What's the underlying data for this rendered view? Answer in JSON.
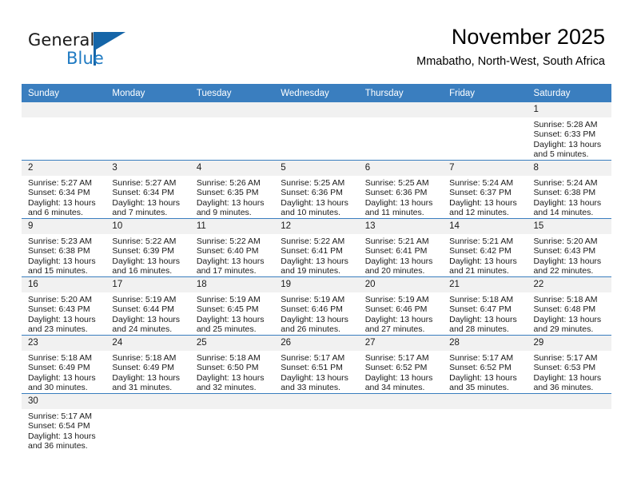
{
  "brand": {
    "name_part1": "General",
    "name_part2": "Blue",
    "flag_icon": "sail-flag-icon",
    "accent_color": "#1f7ac2"
  },
  "header": {
    "month_title": "November 2025",
    "location": "Mmabatho, North-West, South Africa"
  },
  "theme": {
    "header_row_bg": "#3a7ebf",
    "header_row_text": "#ffffff",
    "daynum_bg": "#f1f1f1",
    "grid_line": "#3a7ebf",
    "cell_bg": "#ffffff"
  },
  "weekday_headers": [
    "Sunday",
    "Monday",
    "Tuesday",
    "Wednesday",
    "Thursday",
    "Friday",
    "Saturday"
  ],
  "labels": {
    "sunrise_prefix": "Sunrise: ",
    "sunset_prefix": "Sunset: ",
    "daylight_prefix": "Daylight: "
  },
  "weeks": [
    [
      {
        "day": "",
        "empty": true,
        "sunrise": "",
        "sunset": "",
        "daylight_line1": "",
        "daylight_line2": ""
      },
      {
        "day": "",
        "empty": true,
        "sunrise": "",
        "sunset": "",
        "daylight_line1": "",
        "daylight_line2": ""
      },
      {
        "day": "",
        "empty": true,
        "sunrise": "",
        "sunset": "",
        "daylight_line1": "",
        "daylight_line2": ""
      },
      {
        "day": "",
        "empty": true,
        "sunrise": "",
        "sunset": "",
        "daylight_line1": "",
        "daylight_line2": ""
      },
      {
        "day": "",
        "empty": true,
        "sunrise": "",
        "sunset": "",
        "daylight_line1": "",
        "daylight_line2": ""
      },
      {
        "day": "",
        "empty": true,
        "sunrise": "",
        "sunset": "",
        "daylight_line1": "",
        "daylight_line2": ""
      },
      {
        "day": "1",
        "empty": false,
        "sunrise": "Sunrise: 5:28 AM",
        "sunset": "Sunset: 6:33 PM",
        "daylight_line1": "Daylight: 13 hours",
        "daylight_line2": "and 5 minutes."
      }
    ],
    [
      {
        "day": "2",
        "empty": false,
        "sunrise": "Sunrise: 5:27 AM",
        "sunset": "Sunset: 6:34 PM",
        "daylight_line1": "Daylight: 13 hours",
        "daylight_line2": "and 6 minutes."
      },
      {
        "day": "3",
        "empty": false,
        "sunrise": "Sunrise: 5:27 AM",
        "sunset": "Sunset: 6:34 PM",
        "daylight_line1": "Daylight: 13 hours",
        "daylight_line2": "and 7 minutes."
      },
      {
        "day": "4",
        "empty": false,
        "sunrise": "Sunrise: 5:26 AM",
        "sunset": "Sunset: 6:35 PM",
        "daylight_line1": "Daylight: 13 hours",
        "daylight_line2": "and 9 minutes."
      },
      {
        "day": "5",
        "empty": false,
        "sunrise": "Sunrise: 5:25 AM",
        "sunset": "Sunset: 6:36 PM",
        "daylight_line1": "Daylight: 13 hours",
        "daylight_line2": "and 10 minutes."
      },
      {
        "day": "6",
        "empty": false,
        "sunrise": "Sunrise: 5:25 AM",
        "sunset": "Sunset: 6:36 PM",
        "daylight_line1": "Daylight: 13 hours",
        "daylight_line2": "and 11 minutes."
      },
      {
        "day": "7",
        "empty": false,
        "sunrise": "Sunrise: 5:24 AM",
        "sunset": "Sunset: 6:37 PM",
        "daylight_line1": "Daylight: 13 hours",
        "daylight_line2": "and 12 minutes."
      },
      {
        "day": "8",
        "empty": false,
        "sunrise": "Sunrise: 5:24 AM",
        "sunset": "Sunset: 6:38 PM",
        "daylight_line1": "Daylight: 13 hours",
        "daylight_line2": "and 14 minutes."
      }
    ],
    [
      {
        "day": "9",
        "empty": false,
        "sunrise": "Sunrise: 5:23 AM",
        "sunset": "Sunset: 6:38 PM",
        "daylight_line1": "Daylight: 13 hours",
        "daylight_line2": "and 15 minutes."
      },
      {
        "day": "10",
        "empty": false,
        "sunrise": "Sunrise: 5:22 AM",
        "sunset": "Sunset: 6:39 PM",
        "daylight_line1": "Daylight: 13 hours",
        "daylight_line2": "and 16 minutes."
      },
      {
        "day": "11",
        "empty": false,
        "sunrise": "Sunrise: 5:22 AM",
        "sunset": "Sunset: 6:40 PM",
        "daylight_line1": "Daylight: 13 hours",
        "daylight_line2": "and 17 minutes."
      },
      {
        "day": "12",
        "empty": false,
        "sunrise": "Sunrise: 5:22 AM",
        "sunset": "Sunset: 6:41 PM",
        "daylight_line1": "Daylight: 13 hours",
        "daylight_line2": "and 19 minutes."
      },
      {
        "day": "13",
        "empty": false,
        "sunrise": "Sunrise: 5:21 AM",
        "sunset": "Sunset: 6:41 PM",
        "daylight_line1": "Daylight: 13 hours",
        "daylight_line2": "and 20 minutes."
      },
      {
        "day": "14",
        "empty": false,
        "sunrise": "Sunrise: 5:21 AM",
        "sunset": "Sunset: 6:42 PM",
        "daylight_line1": "Daylight: 13 hours",
        "daylight_line2": "and 21 minutes."
      },
      {
        "day": "15",
        "empty": false,
        "sunrise": "Sunrise: 5:20 AM",
        "sunset": "Sunset: 6:43 PM",
        "daylight_line1": "Daylight: 13 hours",
        "daylight_line2": "and 22 minutes."
      }
    ],
    [
      {
        "day": "16",
        "empty": false,
        "sunrise": "Sunrise: 5:20 AM",
        "sunset": "Sunset: 6:43 PM",
        "daylight_line1": "Daylight: 13 hours",
        "daylight_line2": "and 23 minutes."
      },
      {
        "day": "17",
        "empty": false,
        "sunrise": "Sunrise: 5:19 AM",
        "sunset": "Sunset: 6:44 PM",
        "daylight_line1": "Daylight: 13 hours",
        "daylight_line2": "and 24 minutes."
      },
      {
        "day": "18",
        "empty": false,
        "sunrise": "Sunrise: 5:19 AM",
        "sunset": "Sunset: 6:45 PM",
        "daylight_line1": "Daylight: 13 hours",
        "daylight_line2": "and 25 minutes."
      },
      {
        "day": "19",
        "empty": false,
        "sunrise": "Sunrise: 5:19 AM",
        "sunset": "Sunset: 6:46 PM",
        "daylight_line1": "Daylight: 13 hours",
        "daylight_line2": "and 26 minutes."
      },
      {
        "day": "20",
        "empty": false,
        "sunrise": "Sunrise: 5:19 AM",
        "sunset": "Sunset: 6:46 PM",
        "daylight_line1": "Daylight: 13 hours",
        "daylight_line2": "and 27 minutes."
      },
      {
        "day": "21",
        "empty": false,
        "sunrise": "Sunrise: 5:18 AM",
        "sunset": "Sunset: 6:47 PM",
        "daylight_line1": "Daylight: 13 hours",
        "daylight_line2": "and 28 minutes."
      },
      {
        "day": "22",
        "empty": false,
        "sunrise": "Sunrise: 5:18 AM",
        "sunset": "Sunset: 6:48 PM",
        "daylight_line1": "Daylight: 13 hours",
        "daylight_line2": "and 29 minutes."
      }
    ],
    [
      {
        "day": "23",
        "empty": false,
        "sunrise": "Sunrise: 5:18 AM",
        "sunset": "Sunset: 6:49 PM",
        "daylight_line1": "Daylight: 13 hours",
        "daylight_line2": "and 30 minutes."
      },
      {
        "day": "24",
        "empty": false,
        "sunrise": "Sunrise: 5:18 AM",
        "sunset": "Sunset: 6:49 PM",
        "daylight_line1": "Daylight: 13 hours",
        "daylight_line2": "and 31 minutes."
      },
      {
        "day": "25",
        "empty": false,
        "sunrise": "Sunrise: 5:18 AM",
        "sunset": "Sunset: 6:50 PM",
        "daylight_line1": "Daylight: 13 hours",
        "daylight_line2": "and 32 minutes."
      },
      {
        "day": "26",
        "empty": false,
        "sunrise": "Sunrise: 5:17 AM",
        "sunset": "Sunset: 6:51 PM",
        "daylight_line1": "Daylight: 13 hours",
        "daylight_line2": "and 33 minutes."
      },
      {
        "day": "27",
        "empty": false,
        "sunrise": "Sunrise: 5:17 AM",
        "sunset": "Sunset: 6:52 PM",
        "daylight_line1": "Daylight: 13 hours",
        "daylight_line2": "and 34 minutes."
      },
      {
        "day": "28",
        "empty": false,
        "sunrise": "Sunrise: 5:17 AM",
        "sunset": "Sunset: 6:52 PM",
        "daylight_line1": "Daylight: 13 hours",
        "daylight_line2": "and 35 minutes."
      },
      {
        "day": "29",
        "empty": false,
        "sunrise": "Sunrise: 5:17 AM",
        "sunset": "Sunset: 6:53 PM",
        "daylight_line1": "Daylight: 13 hours",
        "daylight_line2": "and 36 minutes."
      }
    ],
    [
      {
        "day": "30",
        "empty": false,
        "sunrise": "Sunrise: 5:17 AM",
        "sunset": "Sunset: 6:54 PM",
        "daylight_line1": "Daylight: 13 hours",
        "daylight_line2": "and 36 minutes."
      },
      {
        "day": "",
        "empty": true,
        "sunrise": "",
        "sunset": "",
        "daylight_line1": "",
        "daylight_line2": ""
      },
      {
        "day": "",
        "empty": true,
        "sunrise": "",
        "sunset": "",
        "daylight_line1": "",
        "daylight_line2": ""
      },
      {
        "day": "",
        "empty": true,
        "sunrise": "",
        "sunset": "",
        "daylight_line1": "",
        "daylight_line2": ""
      },
      {
        "day": "",
        "empty": true,
        "sunrise": "",
        "sunset": "",
        "daylight_line1": "",
        "daylight_line2": ""
      },
      {
        "day": "",
        "empty": true,
        "sunrise": "",
        "sunset": "",
        "daylight_line1": "",
        "daylight_line2": ""
      },
      {
        "day": "",
        "empty": true,
        "sunrise": "",
        "sunset": "",
        "daylight_line1": "",
        "daylight_line2": ""
      }
    ]
  ]
}
